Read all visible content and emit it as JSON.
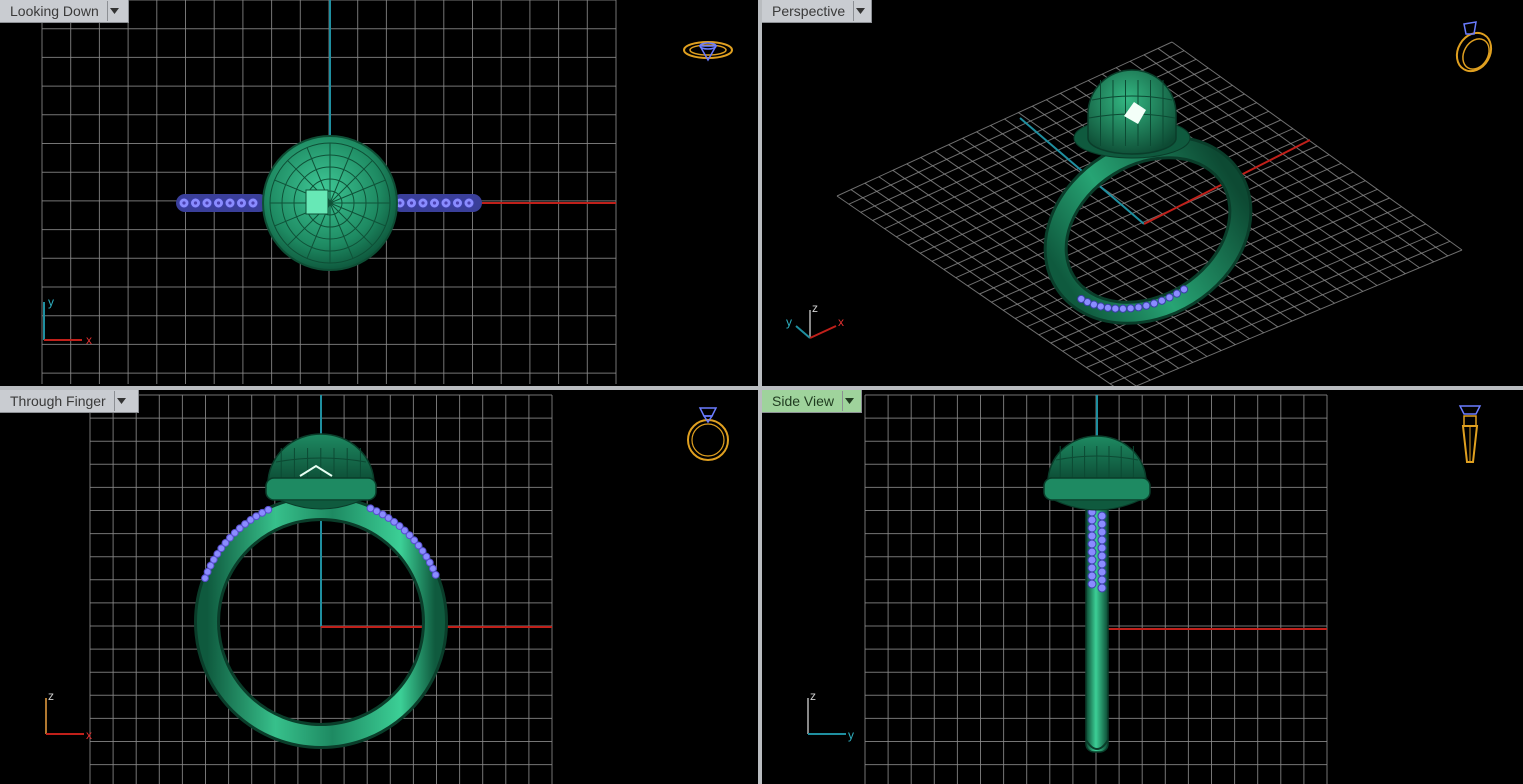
{
  "viewports": {
    "top_left": {
      "label": "Looking Down",
      "axis_h": "x",
      "axis_v": "y"
    },
    "top_right": {
      "label": "Perspective",
      "axis_1": "y",
      "axis_2": "z",
      "axis_3": "x"
    },
    "bottom_left": {
      "label": "Through Finger",
      "axis_h": "x",
      "axis_v": "z"
    },
    "bottom_right": {
      "label": "Side View",
      "axis_h": "y",
      "axis_v": "z"
    }
  },
  "colors": {
    "grid": "#8a8a8a",
    "axis_x": "#c0201a",
    "axis_y": "#1f8fa0",
    "ring_metal": "#1f8a62",
    "pave_stones": "#8a8cff",
    "gizmo": "#e0a020",
    "active_tab": "#9fd39c"
  },
  "icons": {
    "dropdown": "chevron-down-icon",
    "view_gizmo": "ring-view-icon"
  }
}
